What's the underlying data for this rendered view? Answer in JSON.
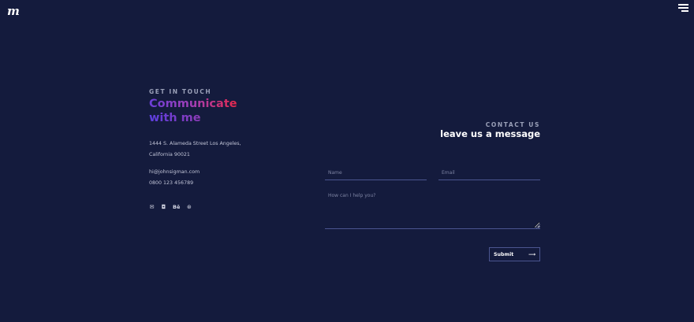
{
  "header": {
    "logo_text": "m",
    "menu_icon": "hamburger-icon"
  },
  "left": {
    "eyebrow": "GET IN TOUCH",
    "headline_line1": "Communicate",
    "headline_line2": "with me",
    "address_line1": "1444 S. Alameda Street Los Angeles,",
    "address_line2": "California 90021",
    "email": "hi@johnsigman.com",
    "phone": "0800 123 456789",
    "socials": [
      {
        "icon": "mail-icon",
        "glyph": "✉"
      },
      {
        "icon": "instagram-icon",
        "glyph": "◘"
      },
      {
        "icon": "behance-icon",
        "glyph": "Bē"
      },
      {
        "icon": "dribbble-icon",
        "glyph": "⊛"
      }
    ]
  },
  "form": {
    "eyebrow": "CONTACT US",
    "title": "leave us a message",
    "name_placeholder": "Name",
    "email_placeholder": "Email",
    "message_placeholder": "How can I help you?",
    "submit_label": "Submit",
    "submit_arrow": "⟶"
  },
  "colors": {
    "background": "#141b3d",
    "accent_start": "#6b3fd8",
    "accent_end": "#e8284a"
  }
}
